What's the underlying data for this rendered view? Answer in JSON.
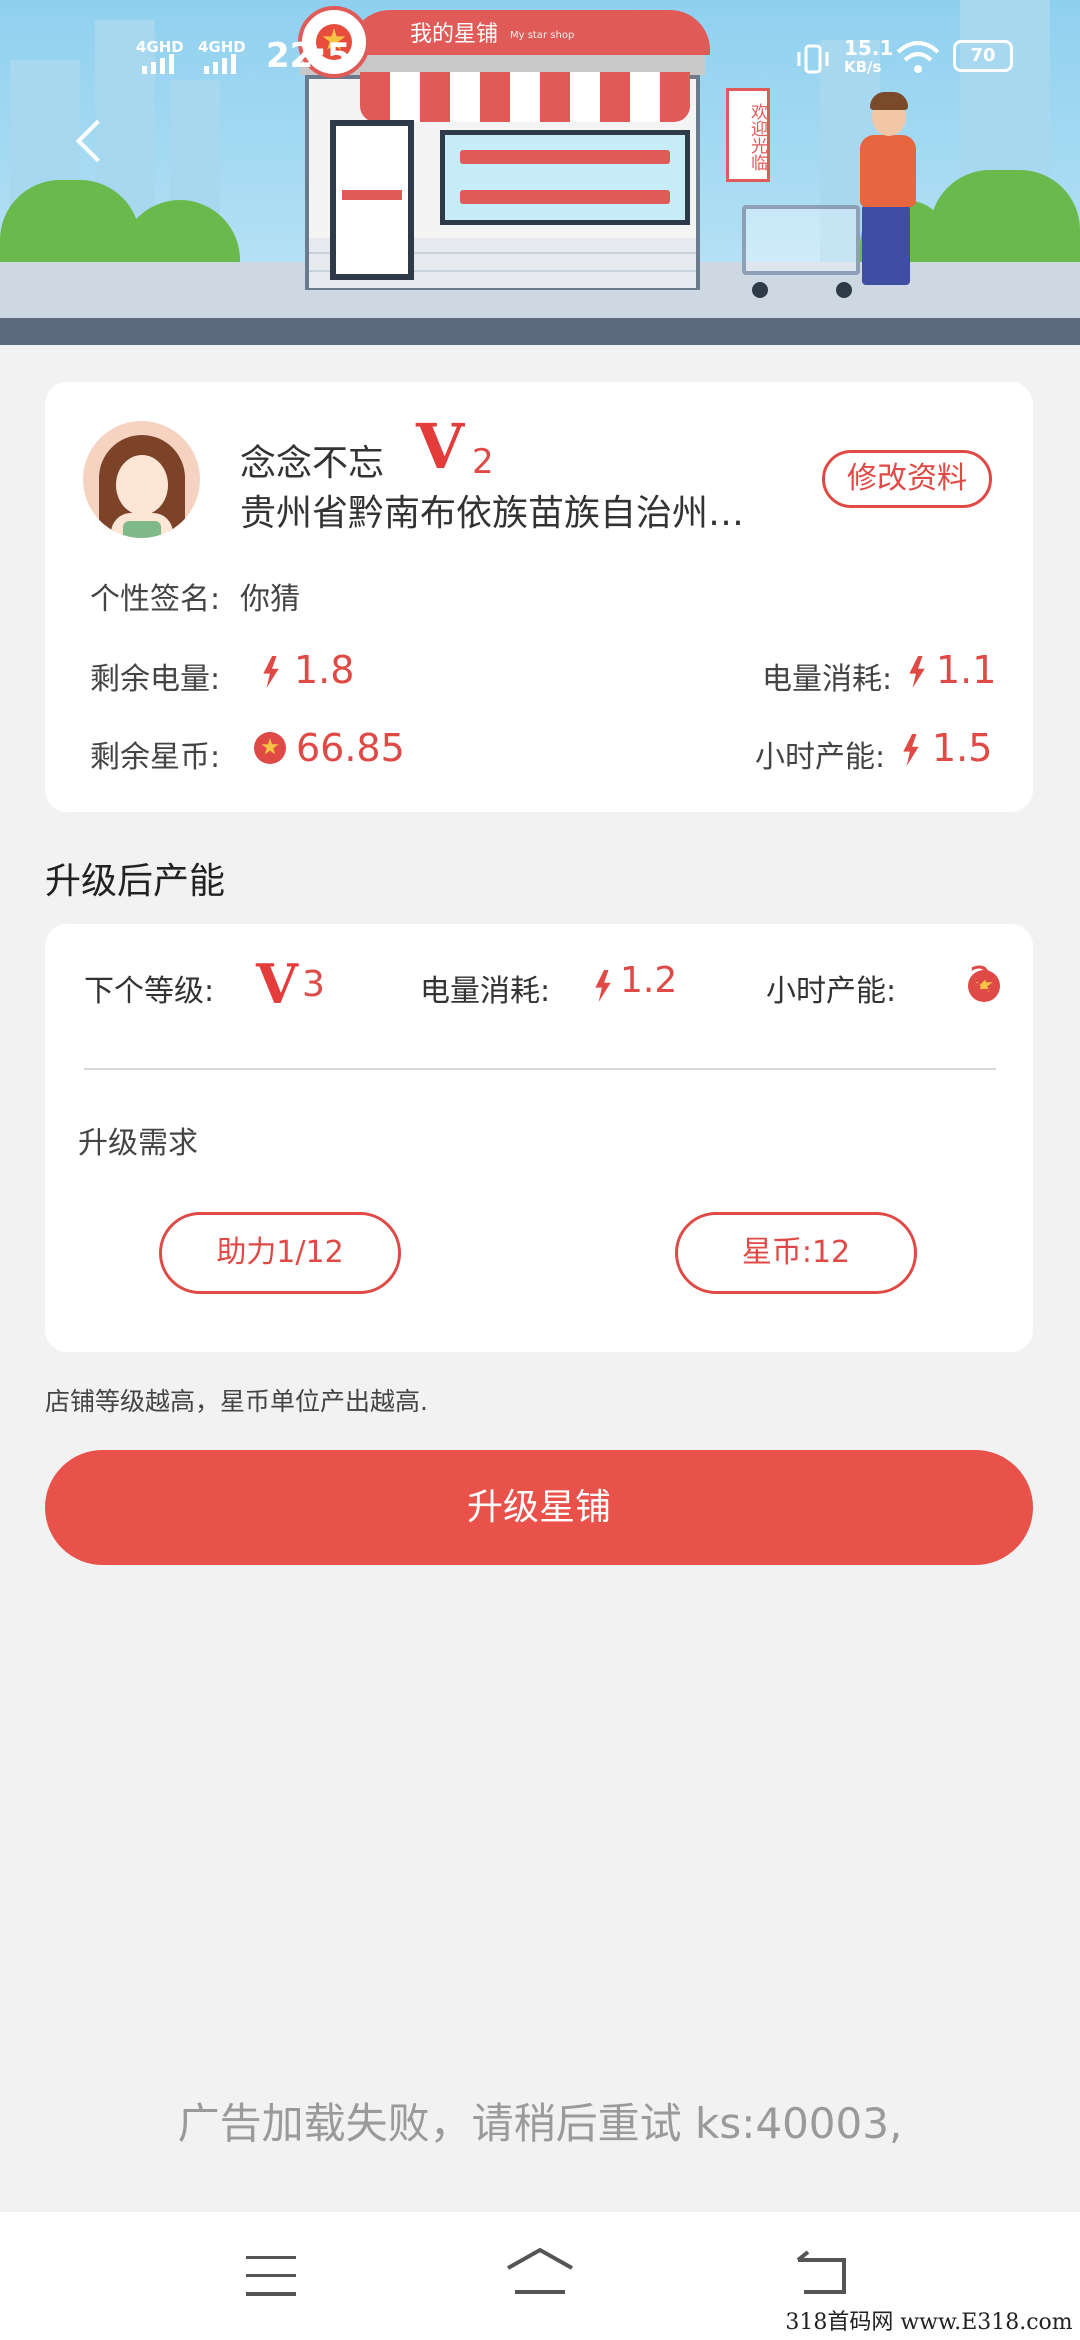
{
  "status_bar": {
    "network_1": "4GHD",
    "network_2": "4GHD",
    "time": "22:5",
    "speed_value": "15.1",
    "speed_unit": "KB/s",
    "battery": "70"
  },
  "banner": {
    "shop_title": "我的星铺",
    "shop_subtitle": "My star shop",
    "welcome_sign": "欢迎光临"
  },
  "profile": {
    "name": "念念不忘",
    "level_letter": "V",
    "level_number": "2",
    "location": "贵州省黔南布依族苗族自治州…",
    "edit_button": "修改资料",
    "signature_label": "个性签名:",
    "signature_value": "你猜",
    "remaining_power_label": "剩余电量:",
    "remaining_power_value": "1.8",
    "power_consumption_label": "电量消耗:",
    "power_consumption_value": "1.1",
    "remaining_coins_label": "剩余星币:",
    "remaining_coins_value": "66.85",
    "hourly_output_label": "小时产能:",
    "hourly_output_value": "1.5"
  },
  "upgrade_section": {
    "title": "升级后产能",
    "next_level_label": "下个等级:",
    "next_level_letter": "V",
    "next_level_number": "3",
    "power_consumption_label": "电量消耗:",
    "power_consumption_value": "1.2",
    "hourly_output_label": "小时产能:",
    "hourly_output_value": "2",
    "requirements_label": "升级需求",
    "assist_button": "助力1/12",
    "coins_button": "星币:12"
  },
  "note": "店铺等级越高，星币单位产出越高.",
  "upgrade_button": "升级星铺",
  "ad_message": "广告加载失败，请稍后重试 ks:40003,",
  "watermark": "318首码网  www.E318.com",
  "colors": {
    "accent": "#e04a46",
    "button": "#e8524a",
    "background": "#f2f2f2"
  },
  "icons": [
    "back-icon",
    "signal-icon",
    "vibrate-icon",
    "wifi-icon",
    "battery-icon",
    "bolt-icon",
    "coin-icon",
    "menu-icon",
    "home-icon",
    "return-icon"
  ]
}
